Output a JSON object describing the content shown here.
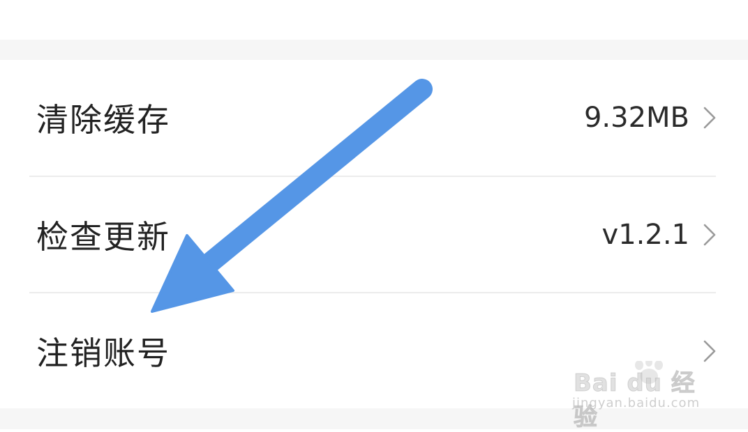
{
  "settings": {
    "items": [
      {
        "label": "清除缓存",
        "value": "9.32MB"
      },
      {
        "label": "检查更新",
        "value": "v1.2.1"
      },
      {
        "label": "注销账号",
        "value": ""
      }
    ]
  },
  "annotation": {
    "arrow_color": "#5596e6",
    "arrow_icon": "arrow-down-left-icon"
  },
  "watermark": {
    "brand": "Bai du 经验",
    "url": "jingyan.baidu.com"
  },
  "colors": {
    "background": "#ffffff",
    "section_gap": "#f6f6f6",
    "divider": "#ececec",
    "text": "#222222",
    "chevron": "#9a9a9a"
  }
}
